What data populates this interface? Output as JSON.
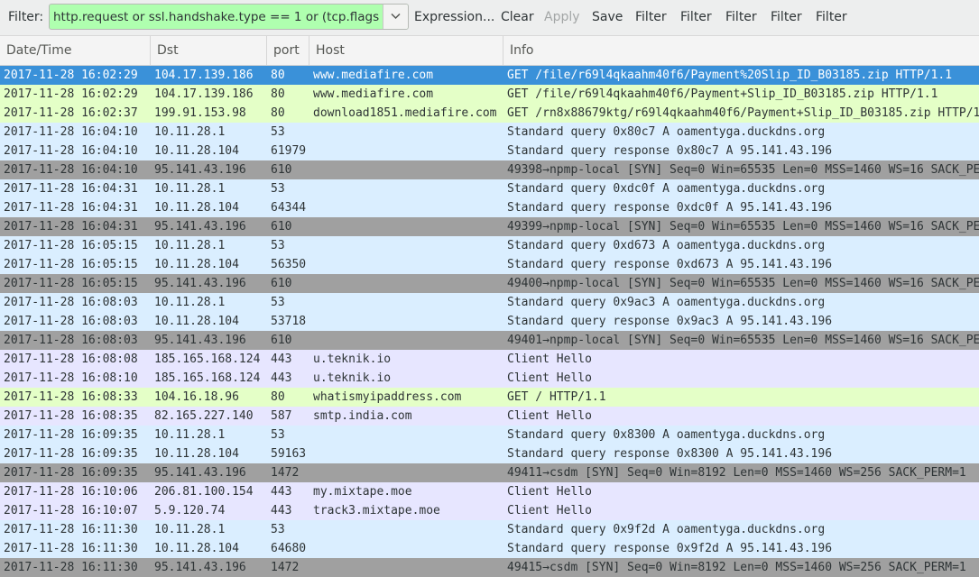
{
  "toolbar": {
    "filter_label": "Filter:",
    "filter_value": "http.request or ssl.handshake.type == 1 or (tcp.flags eq 0x0002 and !ip.dst == 10.11.28.0/24)",
    "expression_label": "Expression...",
    "clear_label": "Clear",
    "apply_label": "Apply",
    "save_label": "Save",
    "filter_buttons": [
      "Filter",
      "Filter",
      "Filter",
      "Filter",
      "Filter"
    ],
    "dropdown_icon": "chevron-down-icon"
  },
  "columns": [
    "Date/Time",
    "Dst",
    "port",
    "Host",
    "Info"
  ],
  "colors": {
    "selected": "#3a91d9",
    "http": "#e4ffc7",
    "dns": "#daeeff",
    "tcp_syn": "#a0a0a0",
    "tls": "#e7e6ff",
    "filter_ok": "#afffaf"
  },
  "rows": [
    {
      "date": "2017-11-28 16:02:29",
      "dst": "104.17.139.186",
      "port": "80",
      "host": "www.mediafire.com",
      "info": "GET /file/r69l4qkaahm40f6/Payment%20Slip_ID_B03185.zip HTTP/1.1",
      "type": "selected"
    },
    {
      "date": "2017-11-28 16:02:29",
      "dst": "104.17.139.186",
      "port": "80",
      "host": "www.mediafire.com",
      "info": "GET /file/r69l4qkaahm40f6/Payment+Slip_ID_B03185.zip HTTP/1.1",
      "type": "http"
    },
    {
      "date": "2017-11-28 16:02:37",
      "dst": "199.91.153.98",
      "port": "80",
      "host": "download1851.mediafire.com",
      "info": "GET /rn8x88679ktg/r69l4qkaahm40f6/Payment+Slip_ID_B03185.zip HTTP/1.1",
      "type": "http"
    },
    {
      "date": "2017-11-28 16:04:10",
      "dst": "10.11.28.1",
      "port": "53",
      "host": "",
      "info": "Standard query 0x80c7  A oamentyga.duckdns.org",
      "type": "dns"
    },
    {
      "date": "2017-11-28 16:04:10",
      "dst": "10.11.28.104",
      "port": "61979",
      "host": "",
      "info": "Standard query response 0x80c7  A 95.141.43.196",
      "type": "dns"
    },
    {
      "date": "2017-11-28 16:04:10",
      "dst": "95.141.43.196",
      "port": "610",
      "host": "",
      "info": "49398→npmp-local [SYN] Seq=0 Win=65535 Len=0 MSS=1460 WS=16 SACK_PERM=1",
      "type": "tcp_syn"
    },
    {
      "date": "2017-11-28 16:04:31",
      "dst": "10.11.28.1",
      "port": "53",
      "host": "",
      "info": "Standard query 0xdc0f  A oamentyga.duckdns.org",
      "type": "dns"
    },
    {
      "date": "2017-11-28 16:04:31",
      "dst": "10.11.28.104",
      "port": "64344",
      "host": "",
      "info": "Standard query response 0xdc0f  A 95.141.43.196",
      "type": "dns"
    },
    {
      "date": "2017-11-28 16:04:31",
      "dst": "95.141.43.196",
      "port": "610",
      "host": "",
      "info": "49399→npmp-local [SYN] Seq=0 Win=65535 Len=0 MSS=1460 WS=16 SACK_PERM=1",
      "type": "tcp_syn"
    },
    {
      "date": "2017-11-28 16:05:15",
      "dst": "10.11.28.1",
      "port": "53",
      "host": "",
      "info": "Standard query 0xd673  A oamentyga.duckdns.org",
      "type": "dns"
    },
    {
      "date": "2017-11-28 16:05:15",
      "dst": "10.11.28.104",
      "port": "56350",
      "host": "",
      "info": "Standard query response 0xd673  A 95.141.43.196",
      "type": "dns"
    },
    {
      "date": "2017-11-28 16:05:15",
      "dst": "95.141.43.196",
      "port": "610",
      "host": "",
      "info": "49400→npmp-local [SYN] Seq=0 Win=65535 Len=0 MSS=1460 WS=16 SACK_PERM=1",
      "type": "tcp_syn"
    },
    {
      "date": "2017-11-28 16:08:03",
      "dst": "10.11.28.1",
      "port": "53",
      "host": "",
      "info": "Standard query 0x9ac3  A oamentyga.duckdns.org",
      "type": "dns"
    },
    {
      "date": "2017-11-28 16:08:03",
      "dst": "10.11.28.104",
      "port": "53718",
      "host": "",
      "info": "Standard query response 0x9ac3  A 95.141.43.196",
      "type": "dns"
    },
    {
      "date": "2017-11-28 16:08:03",
      "dst": "95.141.43.196",
      "port": "610",
      "host": "",
      "info": "49401→npmp-local [SYN] Seq=0 Win=65535 Len=0 MSS=1460 WS=16 SACK_PERM=1",
      "type": "tcp_syn"
    },
    {
      "date": "2017-11-28 16:08:08",
      "dst": "185.165.168.124",
      "port": "443",
      "host": "u.teknik.io",
      "info": "Client Hello",
      "type": "tls"
    },
    {
      "date": "2017-11-28 16:08:10",
      "dst": "185.165.168.124",
      "port": "443",
      "host": "u.teknik.io",
      "info": "Client Hello",
      "type": "tls"
    },
    {
      "date": "2017-11-28 16:08:33",
      "dst": "104.16.18.96",
      "port": "80",
      "host": "whatismyipaddress.com",
      "info": "GET / HTTP/1.1",
      "type": "http"
    },
    {
      "date": "2017-11-28 16:08:35",
      "dst": "82.165.227.140",
      "port": "587",
      "host": "smtp.india.com",
      "info": "Client Hello",
      "type": "tls"
    },
    {
      "date": "2017-11-28 16:09:35",
      "dst": "10.11.28.1",
      "port": "53",
      "host": "",
      "info": "Standard query 0x8300  A oamentyga.duckdns.org",
      "type": "dns"
    },
    {
      "date": "2017-11-28 16:09:35",
      "dst": "10.11.28.104",
      "port": "59163",
      "host": "",
      "info": "Standard query response 0x8300  A 95.141.43.196",
      "type": "dns"
    },
    {
      "date": "2017-11-28 16:09:35",
      "dst": "95.141.43.196",
      "port": "1472",
      "host": "",
      "info": "49411→csdm [SYN] Seq=0 Win=8192 Len=0 MSS=1460 WS=256 SACK_PERM=1",
      "type": "tcp_syn"
    },
    {
      "date": "2017-11-28 16:10:06",
      "dst": "206.81.100.154",
      "port": "443",
      "host": "my.mixtape.moe",
      "info": "Client Hello",
      "type": "tls"
    },
    {
      "date": "2017-11-28 16:10:07",
      "dst": "5.9.120.74",
      "port": "443",
      "host": "track3.mixtape.moe",
      "info": "Client Hello",
      "type": "tls"
    },
    {
      "date": "2017-11-28 16:11:30",
      "dst": "10.11.28.1",
      "port": "53",
      "host": "",
      "info": "Standard query 0x9f2d  A oamentyga.duckdns.org",
      "type": "dns"
    },
    {
      "date": "2017-11-28 16:11:30",
      "dst": "10.11.28.104",
      "port": "64680",
      "host": "",
      "info": "Standard query response 0x9f2d  A 95.141.43.196",
      "type": "dns"
    },
    {
      "date": "2017-11-28 16:11:30",
      "dst": "95.141.43.196",
      "port": "1472",
      "host": "",
      "info": "49415→csdm [SYN] Seq=0 Win=8192 Len=0 MSS=1460 WS=256 SACK_PERM=1",
      "type": "tcp_syn"
    }
  ]
}
